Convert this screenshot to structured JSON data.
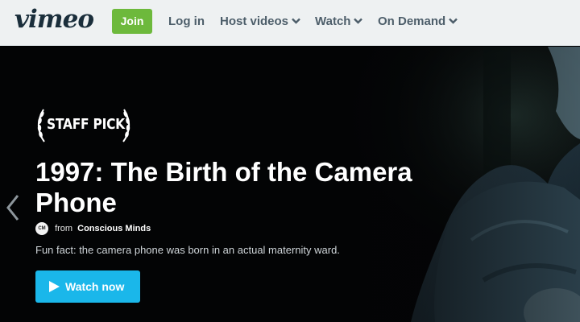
{
  "nav": {
    "logo": "vimeo",
    "join_label": "Join",
    "login_label": "Log in",
    "menu": [
      {
        "label": "Host videos",
        "icon": "chevron-down-icon"
      },
      {
        "label": "Watch",
        "icon": "chevron-down-icon"
      },
      {
        "label": "On Demand",
        "icon": "chevron-down-icon"
      }
    ]
  },
  "hero": {
    "badge": "STAFF PICK",
    "title": "1997: The Birth of the Camera Phone",
    "byline": {
      "avatar_text": "CM",
      "from": "from",
      "owner": "Conscious Minds"
    },
    "description": "Fun fact: the camera phone was born in an actual maternity ward.",
    "watch_label": "Watch now",
    "prev_icon": "chevron-left-icon"
  },
  "colors": {
    "join_green": "#6db93c",
    "watch_blue": "#1ab7ea",
    "nav_bg": "#eef1f2",
    "logo_dark": "#1a2e3b"
  }
}
